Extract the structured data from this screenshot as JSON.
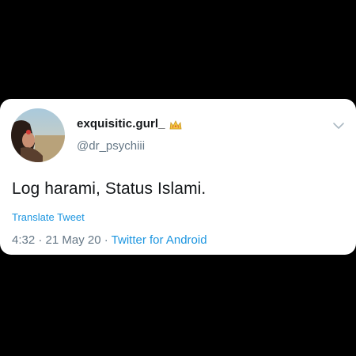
{
  "tweet": {
    "display_name": "exquisitic.gurl_",
    "handle": "@dr_psychiii",
    "text": "Log harami, Status Islami.",
    "translate_label": "Translate Tweet",
    "time": "4:32",
    "separator": "·",
    "date": "21 May 20",
    "source": "Twitter for Android"
  },
  "icons": {
    "avatar": "profile-photo",
    "name_badge": "crown-icon",
    "menu": "chevron-down-icon"
  },
  "colors": {
    "background": "#000000",
    "card": "#ffffff",
    "text_primary": "#14171a",
    "text_secondary": "#657786",
    "link": "#1b95e0",
    "crown": "#f4c542"
  }
}
